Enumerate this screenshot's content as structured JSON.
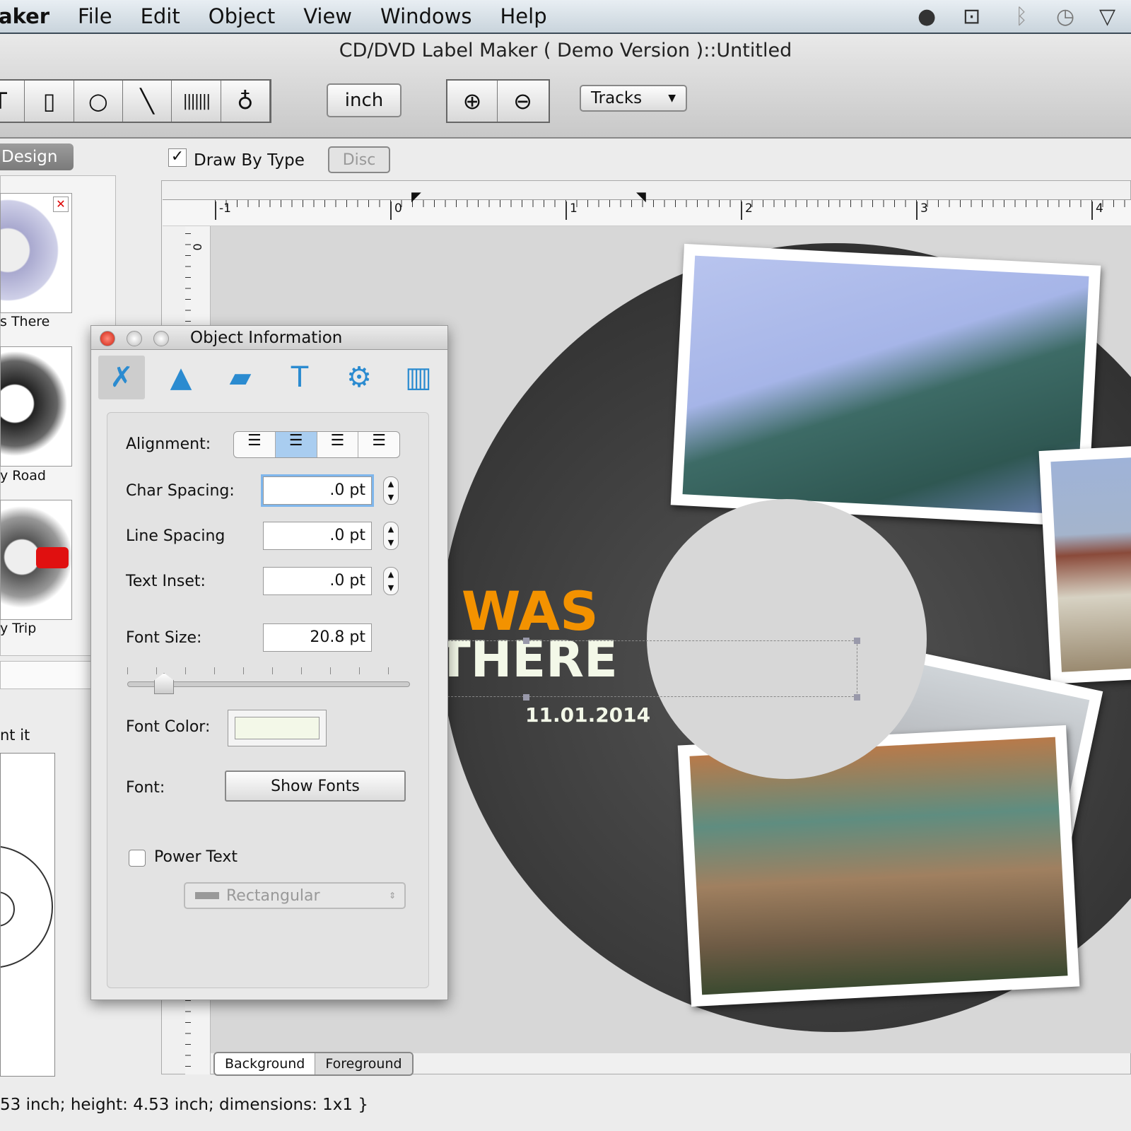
{
  "menubar": {
    "items": [
      "aker",
      "File",
      "Edit",
      "Object",
      "View",
      "Windows",
      "Help"
    ],
    "tray_icons": [
      "qq-penguin-icon",
      "facetime-camera-icon",
      "bluetooth-icon",
      "time-machine-icon",
      "wifi-icon"
    ]
  },
  "window": {
    "title": "CD/DVD Label Maker ( Demo Version )::Untitled"
  },
  "toolbar": {
    "tools": [
      "text-tool",
      "rectangle-tool",
      "ellipse-tool",
      "line-tool",
      "barcode-tool",
      "image-tool"
    ],
    "unit": "inch",
    "zoom_in": "zoom-in",
    "zoom_out": "zoom-out",
    "tracks": "Tracks"
  },
  "sidebar": {
    "tab": "Design",
    "templates": [
      {
        "label": "s There"
      },
      {
        "label": "y Road"
      },
      {
        "label": "y Trip"
      }
    ],
    "section_label": "nt it"
  },
  "canvas_toolbar": {
    "draw_by_type": "Draw By Type",
    "draw_by_type_checked": true,
    "disc_button": "Disc"
  },
  "ruler": {
    "labels": [
      "-1",
      "0",
      "1",
      "2",
      "3",
      "4"
    ],
    "vertical_label": "0"
  },
  "label_design": {
    "line1": "I WAS",
    "line2": "THERE",
    "date": "11.01.2014",
    "accent": "#f39200",
    "text_color": "#f3f8e8",
    "disc_color": "#3a3a3a"
  },
  "layer_tabs": [
    "Background",
    "Foreground"
  ],
  "status": "53 inch; height: 4.53 inch; dimensions: 1x1 }",
  "object_info": {
    "title": "Object Information",
    "tabs": [
      "text-properties",
      "shape-properties",
      "image-properties",
      "text-tool-properties",
      "arrange-properties",
      "barcode-properties"
    ],
    "alignment_label": "Alignment:",
    "alignment_selected": "center",
    "char_spacing_label": "Char Spacing:",
    "char_spacing": ".0 pt",
    "line_spacing_label": "Line Spacing",
    "line_spacing": ".0 pt",
    "text_inset_label": "Text Inset:",
    "text_inset": ".0 pt",
    "font_size_label": "Font Size:",
    "font_size": "20.8 pt",
    "font_size_slider_fraction": 0.13,
    "font_color_label": "Font Color:",
    "font_color": "#f3f8e8",
    "font_label": "Font:",
    "show_fonts": "Show Fonts",
    "power_text": "Power Text",
    "power_text_checked": false,
    "shape_select": "Rectangular"
  }
}
